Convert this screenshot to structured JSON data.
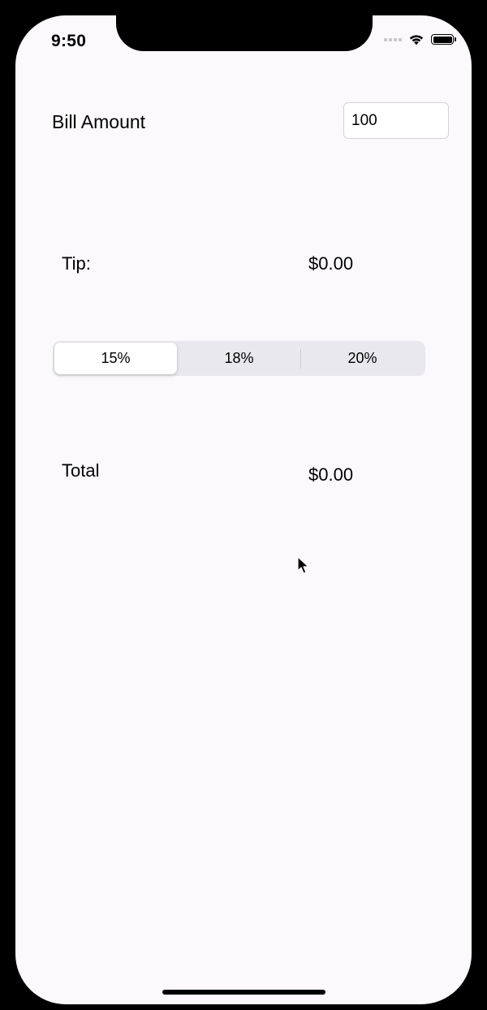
{
  "status_bar": {
    "time": "9:50"
  },
  "bill": {
    "label": "Bill Amount",
    "value": "100",
    "placeholder": ""
  },
  "tip": {
    "label": "Tip:",
    "value": "$0.00"
  },
  "tip_selector": {
    "options": [
      "15%",
      "18%",
      "20%"
    ],
    "selected": "15%"
  },
  "total": {
    "label": "Total",
    "value": "$0.00"
  },
  "icons": [
    "cellular-signal-icon",
    "wifi-icon",
    "battery-icon",
    "mouse-cursor-icon"
  ]
}
